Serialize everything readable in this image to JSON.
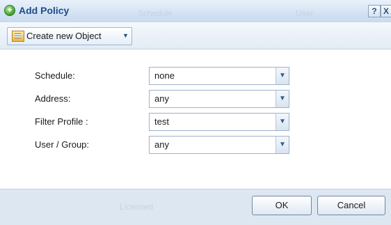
{
  "dialog": {
    "title": "Add Policy",
    "ghost_header": [
      "Schedule",
      "User"
    ],
    "help_label": "?",
    "close_label": "X",
    "title_icon": "add-icon"
  },
  "toolbar": {
    "create_label": "Create new Object",
    "create_caret": "▼",
    "create_icon": "object-icon"
  },
  "form": {
    "fields": [
      {
        "label": "Schedule:",
        "value": "none"
      },
      {
        "label": "Address:",
        "value": "any"
      },
      {
        "label": "Filter Profile :",
        "value": "test"
      },
      {
        "label": "User / Group:",
        "value": "any"
      }
    ],
    "dropdown_arrow": "▼"
  },
  "footer": {
    "ghost_text": "Licensed",
    "ok_label": "OK",
    "cancel_label": "Cancel"
  }
}
